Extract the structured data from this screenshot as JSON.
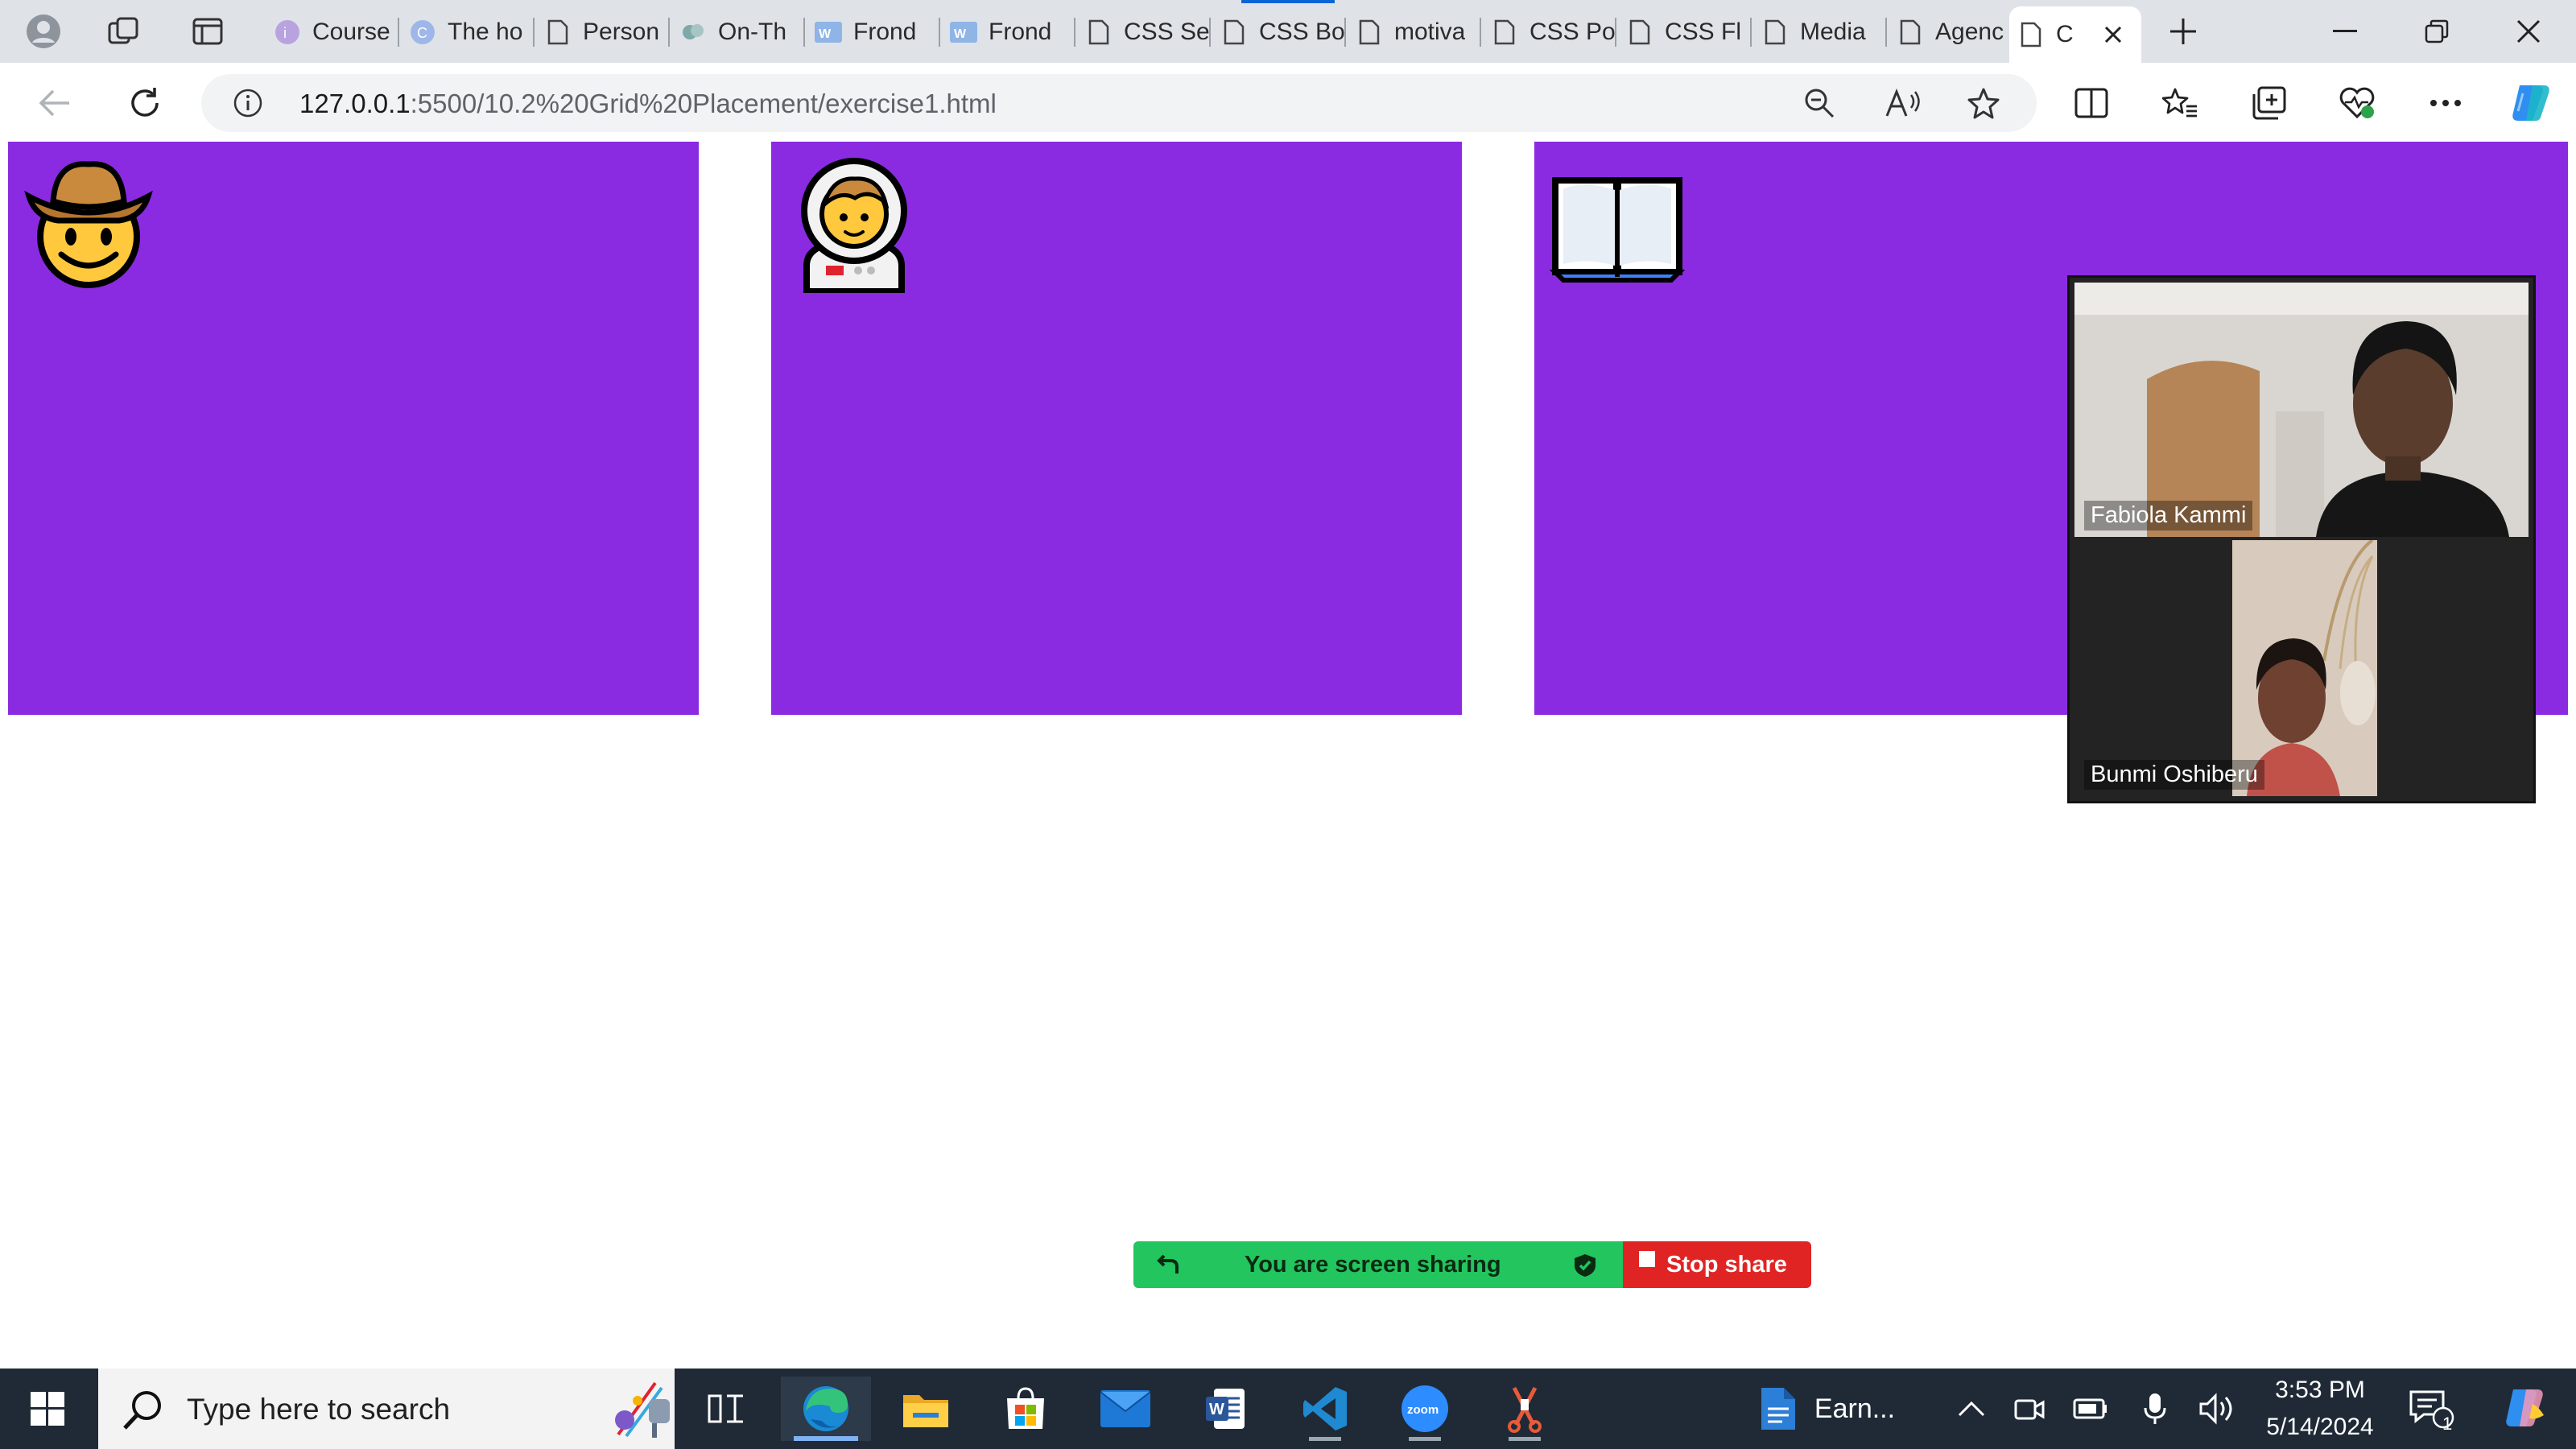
{
  "browser": {
    "tabs": [
      {
        "label": "Course",
        "icon": "coursera-icon"
      },
      {
        "label": "The ho",
        "icon": "canva-icon"
      },
      {
        "label": "Person",
        "icon": "page-icon"
      },
      {
        "label": "On-Th",
        "icon": "app-icon"
      },
      {
        "label": "Frond",
        "icon": "word-icon"
      },
      {
        "label": "Frond",
        "icon": "word-icon"
      },
      {
        "label": "CSS Se",
        "icon": "page-icon"
      },
      {
        "label": "CSS Bo",
        "icon": "page-icon"
      },
      {
        "label": "motiva",
        "icon": "page-icon"
      },
      {
        "label": "CSS Po",
        "icon": "page-icon"
      },
      {
        "label": "CSS Fl",
        "icon": "page-icon"
      },
      {
        "label": "Media",
        "icon": "page-icon"
      },
      {
        "label": "Agenc",
        "icon": "page-icon"
      },
      {
        "label": "C",
        "icon": "page-icon",
        "active": true
      }
    ],
    "address": {
      "host": "127.0.0.1",
      "path": ":5500/10.2%20Grid%20Placement/exercise1.html"
    }
  },
  "page": {
    "background": "#ffffff",
    "cell_color": "#8a2be2",
    "cells": [
      {
        "emoji": "cowboy-face"
      },
      {
        "emoji": "astronaut"
      },
      {
        "emoji": "open-book"
      }
    ]
  },
  "video": {
    "participants": [
      {
        "name": "Fabiola Kammi"
      },
      {
        "name": "Bunmi Oshiberu"
      }
    ]
  },
  "share_bar": {
    "status": "You are screen sharing",
    "stop_label": "Stop share",
    "left_color": "#22c55e",
    "right_color": "#e02424"
  },
  "taskbar": {
    "search_placeholder": "Type here to search",
    "pinned_doc_label": "Earn...",
    "time": "3:53 PM",
    "date": "5/14/2024",
    "notification_count": "1",
    "apps": [
      "task-view-icon",
      "edge-icon",
      "file-explorer-icon",
      "store-icon",
      "mail-icon",
      "word-icon",
      "vscode-icon",
      "zoom-icon",
      "snipping-icon"
    ]
  }
}
